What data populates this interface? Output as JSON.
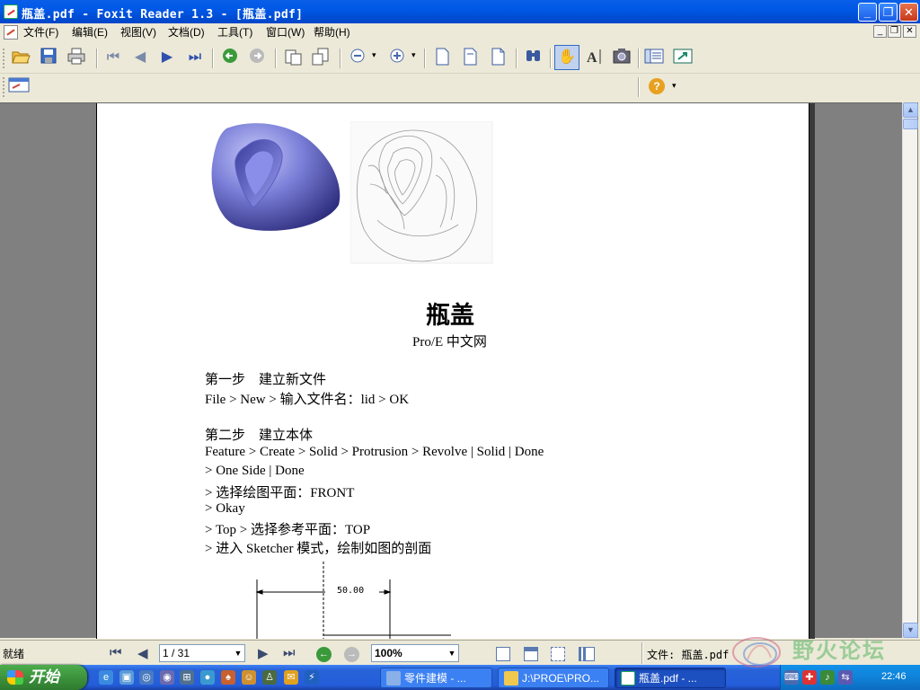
{
  "window": {
    "title": "瓶盖.pdf - Foxit Reader 1.3 - [瓶盖.pdf]"
  },
  "menubar": {
    "items": [
      "文件(F)",
      "编辑(E)",
      "视图(V)",
      "文档(D)",
      "工具(T)",
      "窗口(W)",
      "帮助(H)"
    ]
  },
  "toolbar": {
    "icons": [
      "open-icon",
      "save-icon",
      "print-icon",
      "first-page-icon",
      "prev-page-icon",
      "next-page-icon",
      "last-page-icon",
      "back-icon",
      "forward-icon",
      "rotate-left-icon",
      "rotate-right-icon",
      "zoom-out-icon",
      "zoom-in-icon",
      "single-page-icon",
      "facing-icon",
      "continuous-icon",
      "find-icon",
      "hand-tool-icon",
      "text-select-icon",
      "snapshot-icon",
      "bookmarks-icon",
      "fullscreen-icon"
    ]
  },
  "document": {
    "title": "瓶盖",
    "subtitle": "Pro/E 中文网",
    "lines": [
      "第一步　建立新文件",
      "File > New >  输入文件名：lid > OK",
      "第二步　建立本体",
      "Feature > Create > Solid > Protrusion > Revolve | Solid | Done",
      "> One Side | Done",
      ">  选择绘图平面：FRONT",
      "> Okay",
      "> Top >  选择参考平面：TOP",
      ">  进入 Sketcher 模式，绘制如图的剖面"
    ],
    "sketch_dimension": "50.00"
  },
  "statusbar": {
    "ready": "就绪",
    "page": "1 / 31",
    "zoom": "100%",
    "file_label": "文件: 瓶盖.pdf"
  },
  "taskbar": {
    "start": "开始",
    "tasks": [
      "零件建模 - ...",
      "J:\\PROE\\PRO...",
      "瓶盖.pdf - ..."
    ],
    "clock": "22:46"
  },
  "watermark": {
    "text": "野火论坛"
  },
  "colors": {
    "title_bar": "#0058e6",
    "model_shading": "#7b7fd8",
    "taskbar": "#245edb",
    "start_button": "#3a8e3a"
  }
}
